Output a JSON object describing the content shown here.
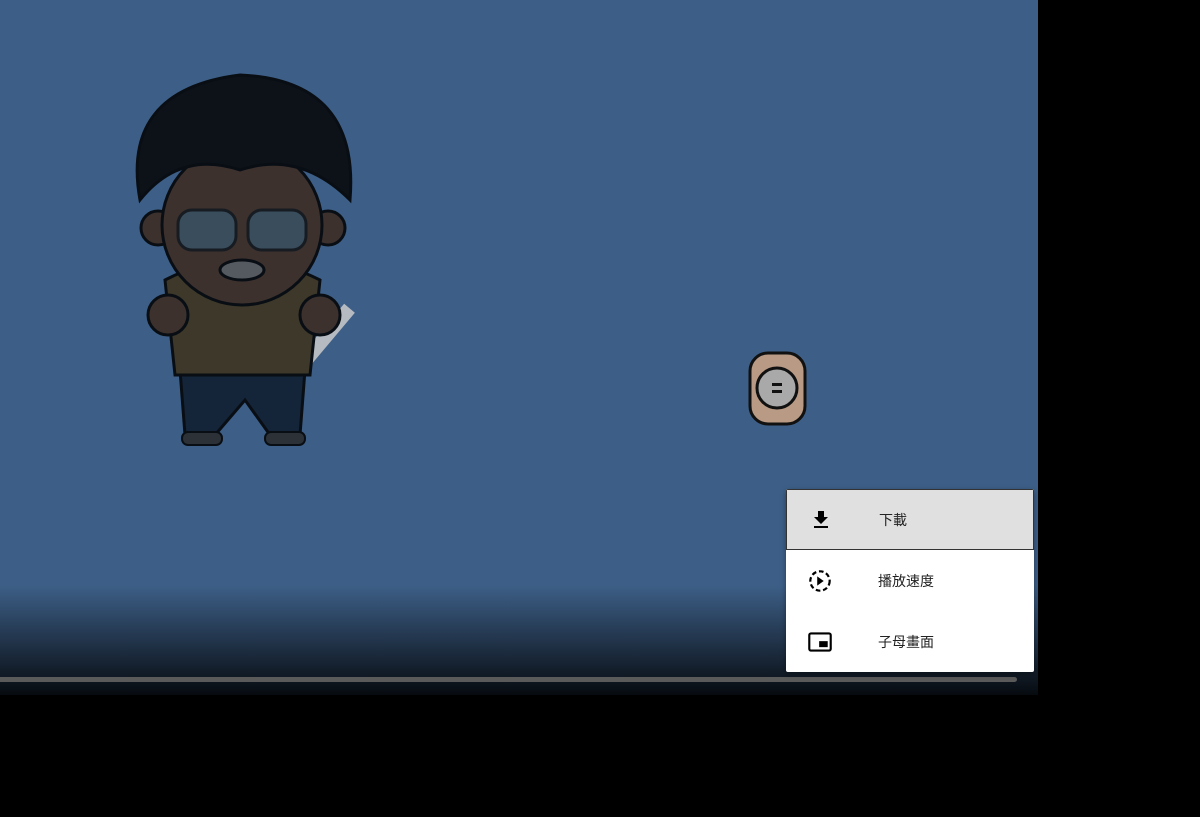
{
  "player": {
    "progress": 0.98,
    "colors": {
      "background": "#3d5f87",
      "menu_highlight": "#e0e0e0"
    }
  },
  "context_menu": {
    "items": [
      {
        "label": "下載",
        "icon": "download-icon"
      },
      {
        "label": "播放速度",
        "icon": "playback-speed-icon"
      },
      {
        "label": "子母畫面",
        "icon": "picture-in-picture-icon"
      }
    ]
  }
}
